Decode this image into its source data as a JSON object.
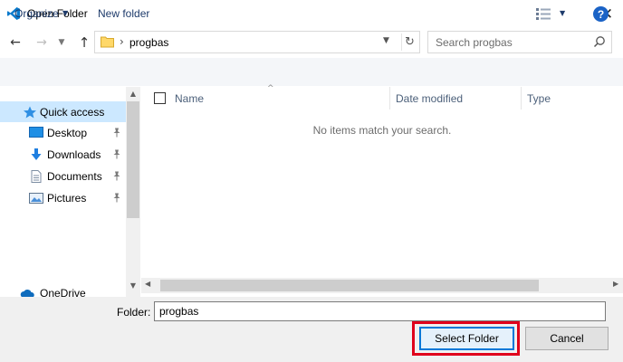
{
  "window": {
    "title": "Open Folder",
    "app_icon": "vscode-logo-icon",
    "close_icon": "close-icon"
  },
  "address": {
    "separator": "›",
    "path": "progbas",
    "search_placeholder": "Search progbas"
  },
  "toolbar": {
    "organize_label": "Organize",
    "new_folder_label": "New folder",
    "help_label": "?"
  },
  "nav": {
    "items": [
      {
        "label": "Quick access",
        "icon": "star-icon",
        "selected": true
      },
      {
        "label": "Desktop",
        "icon": "desktop-icon",
        "pinned": true
      },
      {
        "label": "Downloads",
        "icon": "download-icon",
        "pinned": true
      },
      {
        "label": "Documents",
        "icon": "documents-icon",
        "pinned": true
      },
      {
        "label": "Pictures",
        "icon": "pictures-icon",
        "pinned": true
      },
      {
        "label": "OneDrive",
        "icon": "cloud-icon"
      }
    ]
  },
  "columns": {
    "name": "Name",
    "date_modified": "Date modified",
    "type": "Type"
  },
  "content": {
    "empty_message": "No items match your search."
  },
  "footer": {
    "folder_label": "Folder:",
    "folder_value": "progbas",
    "select_label": "Select Folder",
    "cancel_label": "Cancel"
  },
  "colors": {
    "selection": "#cce8ff",
    "accent": "#0078d7",
    "highlight": "#e0001b",
    "help": "#1b63c6"
  }
}
